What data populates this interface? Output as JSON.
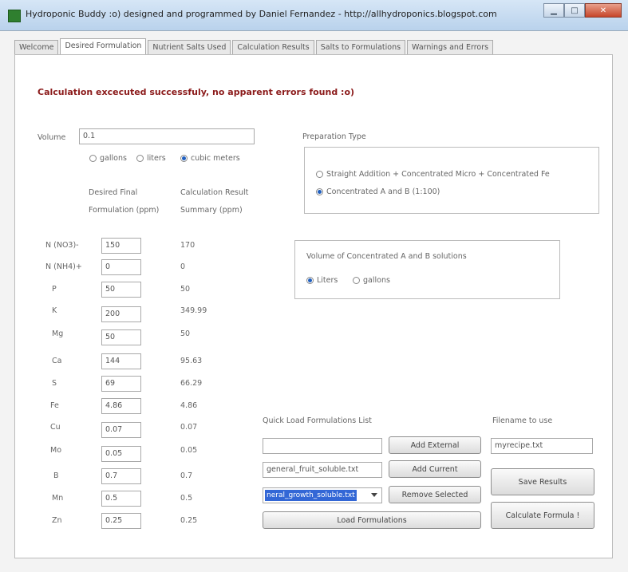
{
  "window": {
    "title": "Hydroponic Buddy :o) designed and programmed by Daniel Fernandez - http://allhydroponics.blogspot.com"
  },
  "tabs": [
    {
      "label": "Welcome"
    },
    {
      "label": "Desired Formulation"
    },
    {
      "label": "Nutrient Salts Used"
    },
    {
      "label": "Calculation Results"
    },
    {
      "label": "Salts to Formulations"
    },
    {
      "label": "Warnings and Errors"
    }
  ],
  "status_message": "Calculation excecuted successfuly, no apparent errors found :o)",
  "volume": {
    "label": "Volume",
    "value": "0.1",
    "units": [
      {
        "label": "gallons",
        "selected": false
      },
      {
        "label": "liters",
        "selected": false
      },
      {
        "label": "cubic meters",
        "selected": true
      }
    ]
  },
  "columns": {
    "desired_line1": "Desired Final",
    "desired_line2": "Formulation (ppm)",
    "result_line1": "Calculation Result",
    "result_line2": "Summary (ppm)"
  },
  "nutrients": [
    {
      "name": "N (NO3)-",
      "desired": "150",
      "result": "170"
    },
    {
      "name": "N (NH4)+",
      "desired": "0",
      "result": "0"
    },
    {
      "name": "P",
      "desired": "50",
      "result": "50"
    },
    {
      "name": "K",
      "desired": "200",
      "result": "349.99"
    },
    {
      "name": "Mg",
      "desired": "50",
      "result": "50"
    },
    {
      "name": "Ca",
      "desired": "144",
      "result": "95.63"
    },
    {
      "name": "S",
      "desired": "69",
      "result": "66.29"
    },
    {
      "name": "Fe",
      "desired": "4.86",
      "result": "4.86"
    },
    {
      "name": "Cu",
      "desired": "0.07",
      "result": "0.07"
    },
    {
      "name": "Mo",
      "desired": "0.05",
      "result": "0.05"
    },
    {
      "name": "B",
      "desired": "0.7",
      "result": "0.7"
    },
    {
      "name": "Mn",
      "desired": "0.5",
      "result": "0.5"
    },
    {
      "name": "Zn",
      "desired": "0.25",
      "result": "0.25"
    }
  ],
  "preparation": {
    "label": "Preparation Type",
    "options": [
      {
        "label": "Straight Addition + Concentrated Micro + Concentrated Fe",
        "selected": false
      },
      {
        "label": "Concentrated A and B (1:100)",
        "selected": true
      }
    ]
  },
  "concentrated": {
    "label": "Volume of Concentrated A and B solutions",
    "options": [
      {
        "label": "Liters",
        "selected": true
      },
      {
        "label": "gallons",
        "selected": false
      }
    ]
  },
  "quick_load": {
    "label": "Quick Load Formulations List",
    "external_value": "",
    "current_value": "general_fruit_soluble.txt",
    "selected_value": "neral_growth_soluble.txt",
    "add_external": "Add External",
    "add_current": "Add Current",
    "remove_selected": "Remove Selected",
    "load": "Load Formulations"
  },
  "filename": {
    "label": "Filename to use",
    "value": "myrecipe.txt",
    "save": "Save Results",
    "calculate": "Calculate Formula !"
  }
}
